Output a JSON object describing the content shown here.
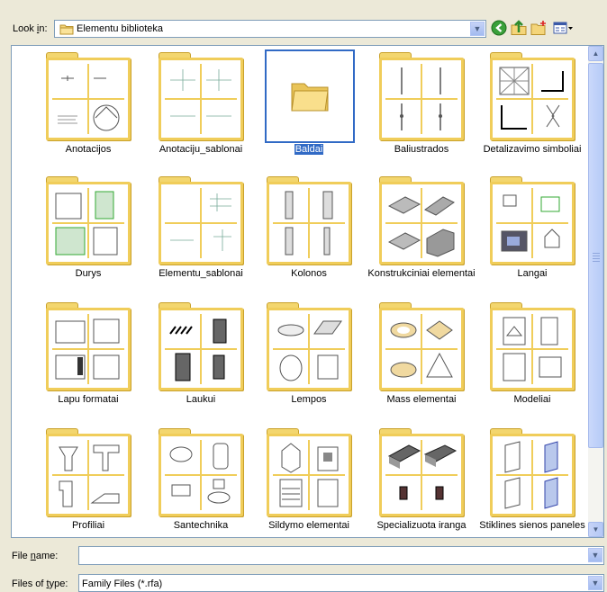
{
  "lookin": {
    "label_pre": "Look ",
    "label_u": "i",
    "label_post": "n:",
    "value": "Elementu biblioteka"
  },
  "toolbar": {
    "back_icon": "back-arrow-icon",
    "up_icon": "up-folder-icon",
    "newfolder_icon": "new-folder-icon",
    "views_icon": "views-menu-icon"
  },
  "files": [
    {
      "label": "Anotacijos"
    },
    {
      "label": "Anotaciju_sablonai"
    },
    {
      "label": "Baldai",
      "selected": true
    },
    {
      "label": "Baliustrados"
    },
    {
      "label": "Detalizavimo simboliai"
    },
    {
      "label": "Durys"
    },
    {
      "label": "Elementu_sablonai"
    },
    {
      "label": "Kolonos"
    },
    {
      "label": "Konstrukciniai elementai"
    },
    {
      "label": "Langai"
    },
    {
      "label": "Lapu formatai"
    },
    {
      "label": "Laukui"
    },
    {
      "label": "Lempos"
    },
    {
      "label": "Mass elementai"
    },
    {
      "label": "Modeliai"
    },
    {
      "label": "Profiliai"
    },
    {
      "label": "Santechnika"
    },
    {
      "label": "Sildymo elementai"
    },
    {
      "label": "Specializuota iranga"
    },
    {
      "label": "Stiklines sienos paneles"
    }
  ],
  "file_name": {
    "label_pre": "File ",
    "label_u": "n",
    "label_post": "ame:",
    "value": ""
  },
  "file_type": {
    "label_pre": "Files of ",
    "label_u": "t",
    "label_post": "ype:",
    "value": "Family Files (*.rfa)"
  },
  "colors": {
    "selection": "#316ac5",
    "folder": "#f0cd5a",
    "dialog_bg": "#ece9d8"
  }
}
